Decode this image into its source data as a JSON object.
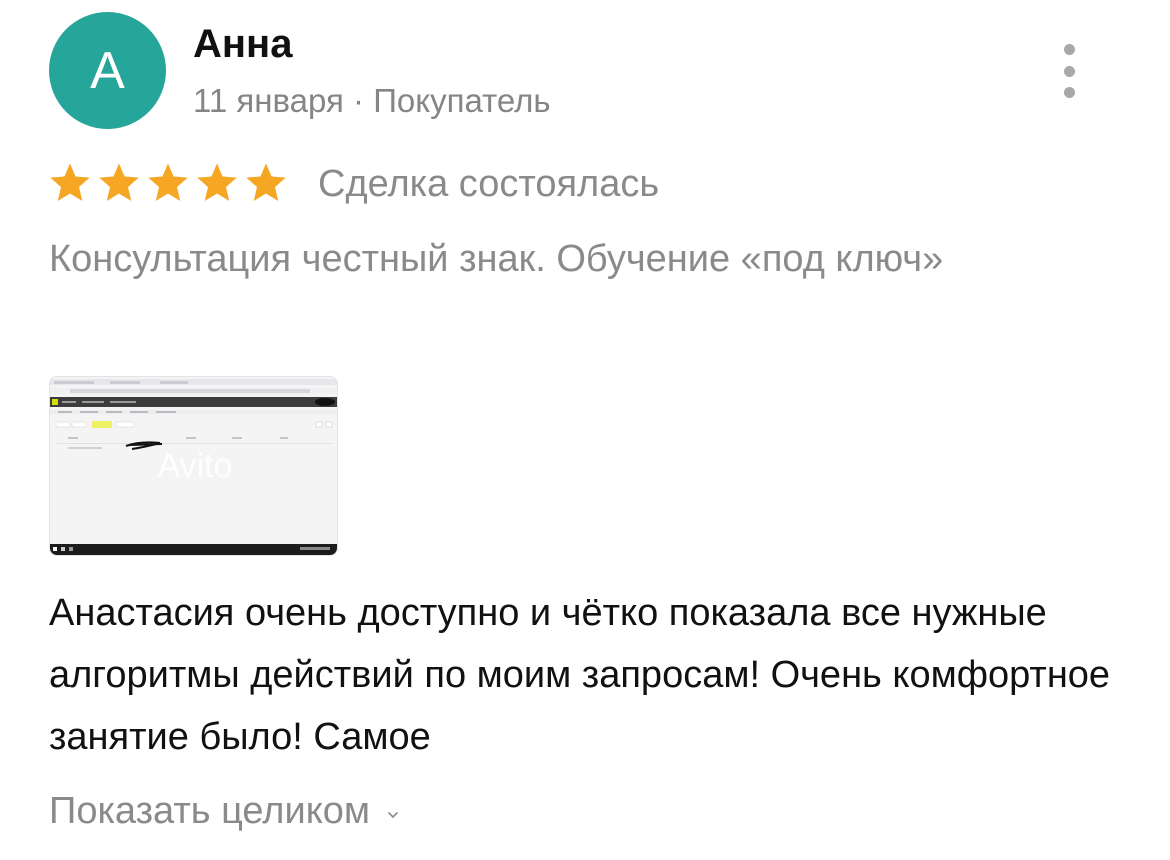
{
  "review": {
    "avatar_letter": "А",
    "avatar_color": "#26a69a",
    "author": "Анна",
    "meta": "11 января · Покупатель",
    "rating": 5,
    "star_color": "#f5a623",
    "deal_status": "Сделка состоялась",
    "service": "Консультация честный знак. Обучение «под ключ»",
    "photo": {
      "description_icon": "screenshot-thumbnail",
      "watermark": "Avito"
    },
    "text": "Анастасия очень доступно и чётко показала все нужные алгоритмы действий по моим запросам! Очень комфортное занятие было! Самое",
    "show_more_label": "Показать целиком"
  },
  "icons": {
    "more": "more-vertical-icon",
    "star": "star-icon",
    "chevron": "chevron-down-icon"
  }
}
